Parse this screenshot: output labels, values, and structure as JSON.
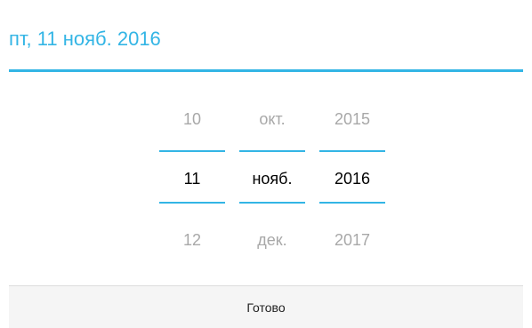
{
  "header": {
    "title": "пт, 11 нояб. 2016"
  },
  "pickers": {
    "day": {
      "previous": "10",
      "current": "11",
      "next": "12"
    },
    "month": {
      "previous": "окт.",
      "current": "нояб.",
      "next": "дек."
    },
    "year": {
      "previous": "2015",
      "current": "2016",
      "next": "2017"
    }
  },
  "footer": {
    "done_label": "Готово"
  },
  "colors": {
    "accent": "#33b5e5",
    "inactive_text": "#a8a8a8",
    "active_text": "#000000"
  }
}
